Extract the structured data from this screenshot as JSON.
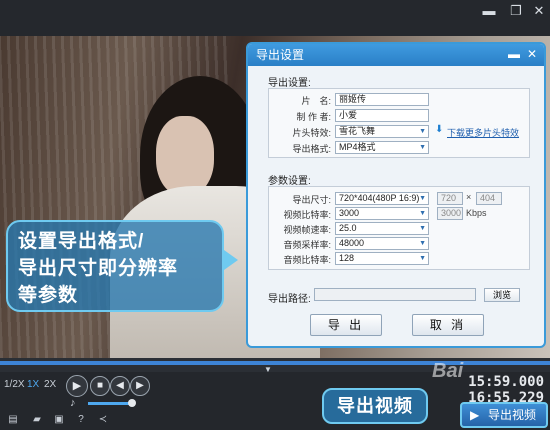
{
  "window": {
    "minimize_icon": "minimize-icon",
    "restore_icon": "restore-icon",
    "close_icon": "close-icon"
  },
  "callout": {
    "line1": "设置导出格式/",
    "line2": "导出尺寸即分辨率",
    "line3": "等参数"
  },
  "dialog": {
    "title": "导出设置",
    "section_export": "导出设置:",
    "title_label": "片　名:",
    "title_value": "丽姬传",
    "author_label": "制 作 者:",
    "author_value": "小爱",
    "effect_label": "片头特效:",
    "effect_value": "雪花飞舞",
    "download_link": "下载更多片头特效",
    "format_label": "导出格式:",
    "format_value": "MP4格式",
    "section_params": "参数设置:",
    "size_label": "导出尺寸:",
    "size_value": "720*404(480P 16:9)",
    "width_value": "720",
    "height_value": "404",
    "times_sign": "×",
    "vbitrate_label": "视频比特率:",
    "vbitrate_value": "3000",
    "vbitrate_box": "3000",
    "vbitrate_unit": "Kbps",
    "framerate_label": "视频帧速率:",
    "framerate_value": "25.0",
    "samplerate_label": "音频采样率:",
    "samplerate_value": "48000",
    "abitrate_label": "音频比特率:",
    "abitrate_value": "128",
    "path_label": "导出路径:",
    "path_value": "",
    "browse_label": "浏览",
    "export_label": "导 出",
    "cancel_label": "取 消"
  },
  "controls": {
    "speeds": [
      "1/2X",
      "1X",
      "2X"
    ],
    "active_speed": "1X",
    "time_current": "15:59.000",
    "time_total": "16:55.229",
    "export_bubble": "导出视频",
    "export_button": "导出视频",
    "watermark": "Bai"
  },
  "colors": {
    "accent": "#3a9ad9",
    "callout": "#6fcaf0",
    "progress": "#3d84d6"
  }
}
